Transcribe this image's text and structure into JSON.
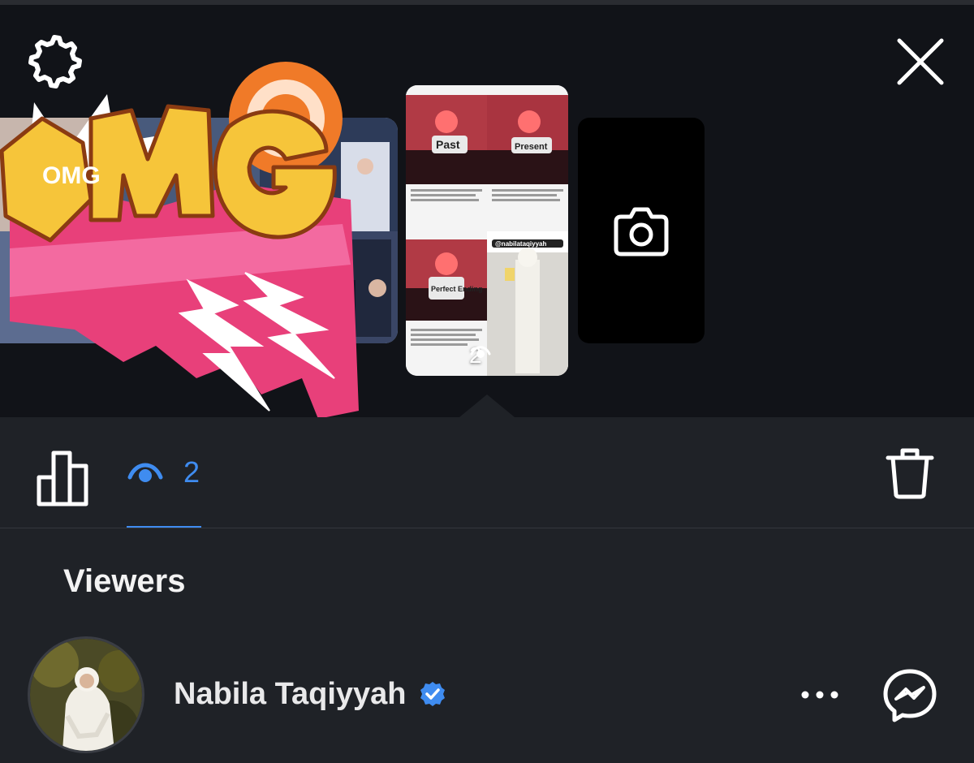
{
  "header": {
    "settings_icon": "gear-icon",
    "close_icon": "close-icon"
  },
  "stories": {
    "sticker_text": "OMG",
    "selected_thumbnail": {
      "captions": [
        "Past",
        "Present",
        "Perfect Ending"
      ],
      "handle": "@nabilataqiyyah",
      "views": "2"
    },
    "camera_icon": "camera-icon"
  },
  "tabs": {
    "insights_icon": "bar-chart-icon",
    "viewers_icon": "eye-icon",
    "viewers_count": "2",
    "delete_icon": "trash-icon",
    "active_color": "#3f8cf0"
  },
  "viewers": {
    "title": "Viewers",
    "list": [
      {
        "name": "Nabila Taqiyyah",
        "verified": true,
        "verified_color": "#3f8cf0"
      }
    ]
  }
}
